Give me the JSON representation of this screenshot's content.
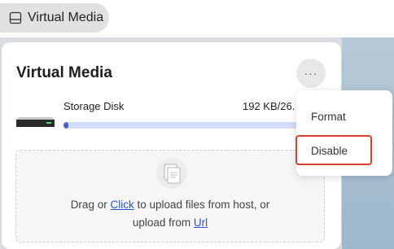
{
  "header": {
    "crumb_label": "Virtual Media"
  },
  "card": {
    "title": "Virtual Media",
    "more_label": "···",
    "disk": {
      "name": "Storage Disk",
      "size": "192 KB/26.",
      "progress": 0.01
    },
    "upload": {
      "line1_prefix": "Drag or ",
      "click_label": "Click",
      "line1_suffix": " to upload files from host, or",
      "line2_prefix": "upload from ",
      "url_label": "Url"
    }
  },
  "menu": {
    "items": [
      {
        "label": "Format"
      },
      {
        "label": "Disable"
      }
    ]
  },
  "icons": {
    "crumb": "drive-icon",
    "disk": "disk-drive-icon",
    "upload": "upload-files-icon",
    "more": "more-icon"
  },
  "colors": {
    "accent": "#4b60d8",
    "track": "#d5dcfb",
    "link": "#2b55d6",
    "highlight": "#d9402f"
  }
}
